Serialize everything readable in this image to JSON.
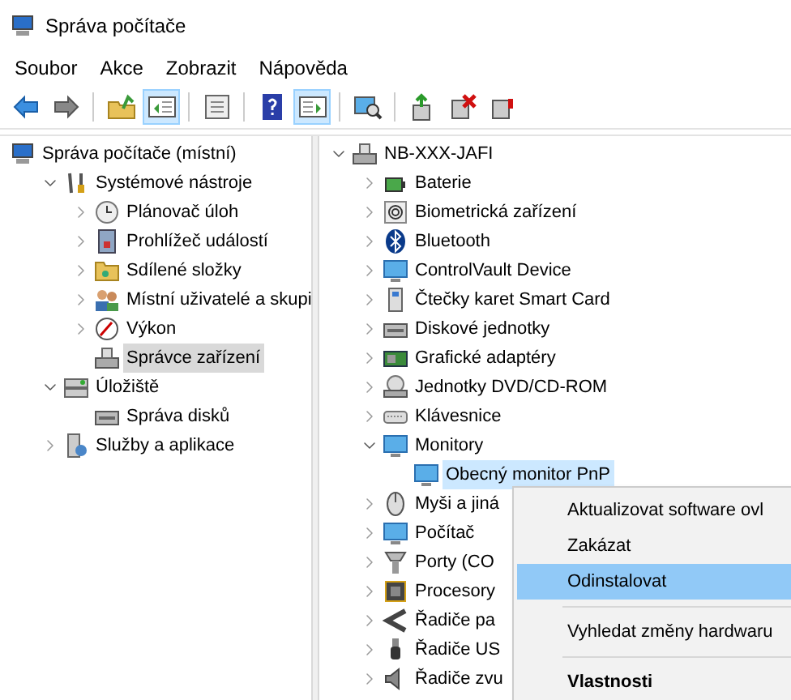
{
  "window": {
    "title": "Správa počítače"
  },
  "menu": [
    "Soubor",
    "Akce",
    "Zobrazit",
    "Nápověda"
  ],
  "toolbar": [
    {
      "kind": "back",
      "pressed": false
    },
    {
      "kind": "forward",
      "pressed": false
    },
    {
      "kind": "sep"
    },
    {
      "kind": "up",
      "pressed": false
    },
    {
      "kind": "tree",
      "pressed": true
    },
    {
      "kind": "sep"
    },
    {
      "kind": "props",
      "pressed": false
    },
    {
      "kind": "sep"
    },
    {
      "kind": "help",
      "pressed": false
    },
    {
      "kind": "pane",
      "pressed": true
    },
    {
      "kind": "sep"
    },
    {
      "kind": "scan",
      "pressed": false
    },
    {
      "kind": "sep"
    },
    {
      "kind": "update",
      "pressed": false
    },
    {
      "kind": "disable",
      "pressed": false
    },
    {
      "kind": "uninstall",
      "pressed": false
    }
  ],
  "left_tree": [
    {
      "label": "Správa počítače (místní)",
      "selected": false,
      "children": [
        {
          "label": "Systémové nástroje",
          "expanded": true,
          "selected": false,
          "children": [
            {
              "label": "Plánovač úloh",
              "expanded": false,
              "selected": false
            },
            {
              "label": "Prohlížeč událostí",
              "expanded": false,
              "selected": false
            },
            {
              "label": "Sdílené složky",
              "expanded": false,
              "selected": false
            },
            {
              "label": "Místní uživatelé a skupi",
              "expanded": false,
              "selected": false
            },
            {
              "label": "Výkon",
              "expanded": false,
              "selected": false
            },
            {
              "label": "Správce zařízení",
              "selected": true
            }
          ]
        },
        {
          "label": "Úložiště",
          "expanded": true,
          "selected": false,
          "children": [
            {
              "label": "Správa disků",
              "selected": false
            }
          ]
        },
        {
          "label": "Služby a aplikace",
          "expanded": false,
          "selected": false
        }
      ]
    }
  ],
  "right_tree": [
    {
      "label": "NB-XXX-JAFI",
      "expanded": true,
      "selected": false,
      "children": [
        {
          "label": "Baterie",
          "expanded": false,
          "selected": false
        },
        {
          "label": "Biometrická zařízení",
          "expanded": false,
          "selected": false
        },
        {
          "label": "Bluetooth",
          "expanded": false,
          "selected": false
        },
        {
          "label": "ControlVault Device",
          "expanded": false,
          "selected": false
        },
        {
          "label": "Čtečky karet Smart Card",
          "expanded": false,
          "selected": false
        },
        {
          "label": "Diskové jednotky",
          "expanded": false,
          "selected": false
        },
        {
          "label": "Grafické adaptéry",
          "expanded": false,
          "selected": false
        },
        {
          "label": "Jednotky DVD/CD-ROM",
          "expanded": false,
          "selected": false
        },
        {
          "label": "Klávesnice",
          "expanded": false,
          "selected": false
        },
        {
          "label": "Monitory",
          "expanded": true,
          "selected": false,
          "children": [
            {
              "label": "Obecný monitor PnP",
              "selected": true
            }
          ]
        },
        {
          "label": "Myši a jiná",
          "expanded": false,
          "selected": false
        },
        {
          "label": "Počítač",
          "expanded": false,
          "selected": false
        },
        {
          "label": "Porty (CO",
          "expanded": false,
          "selected": false
        },
        {
          "label": "Procesory",
          "expanded": false,
          "selected": false
        },
        {
          "label": "Řadiče pa",
          "expanded": false,
          "selected": false
        },
        {
          "label": "Řadiče US",
          "expanded": false,
          "selected": false
        },
        {
          "label": "Řadiče zvu",
          "expanded": false,
          "selected": false
        }
      ]
    }
  ],
  "context_menu": [
    {
      "kind": "item",
      "label": "Aktualizovat software ovl",
      "selected": false,
      "bold": false
    },
    {
      "kind": "item",
      "label": "Zakázat",
      "selected": false,
      "bold": false
    },
    {
      "kind": "item",
      "label": "Odinstalovat",
      "selected": true,
      "bold": false
    },
    {
      "kind": "separator"
    },
    {
      "kind": "item",
      "label": "Vyhledat změny hardwaru",
      "selected": false,
      "bold": false
    },
    {
      "kind": "separator"
    },
    {
      "kind": "item",
      "label": "Vlastnosti",
      "selected": false,
      "bold": true
    }
  ]
}
